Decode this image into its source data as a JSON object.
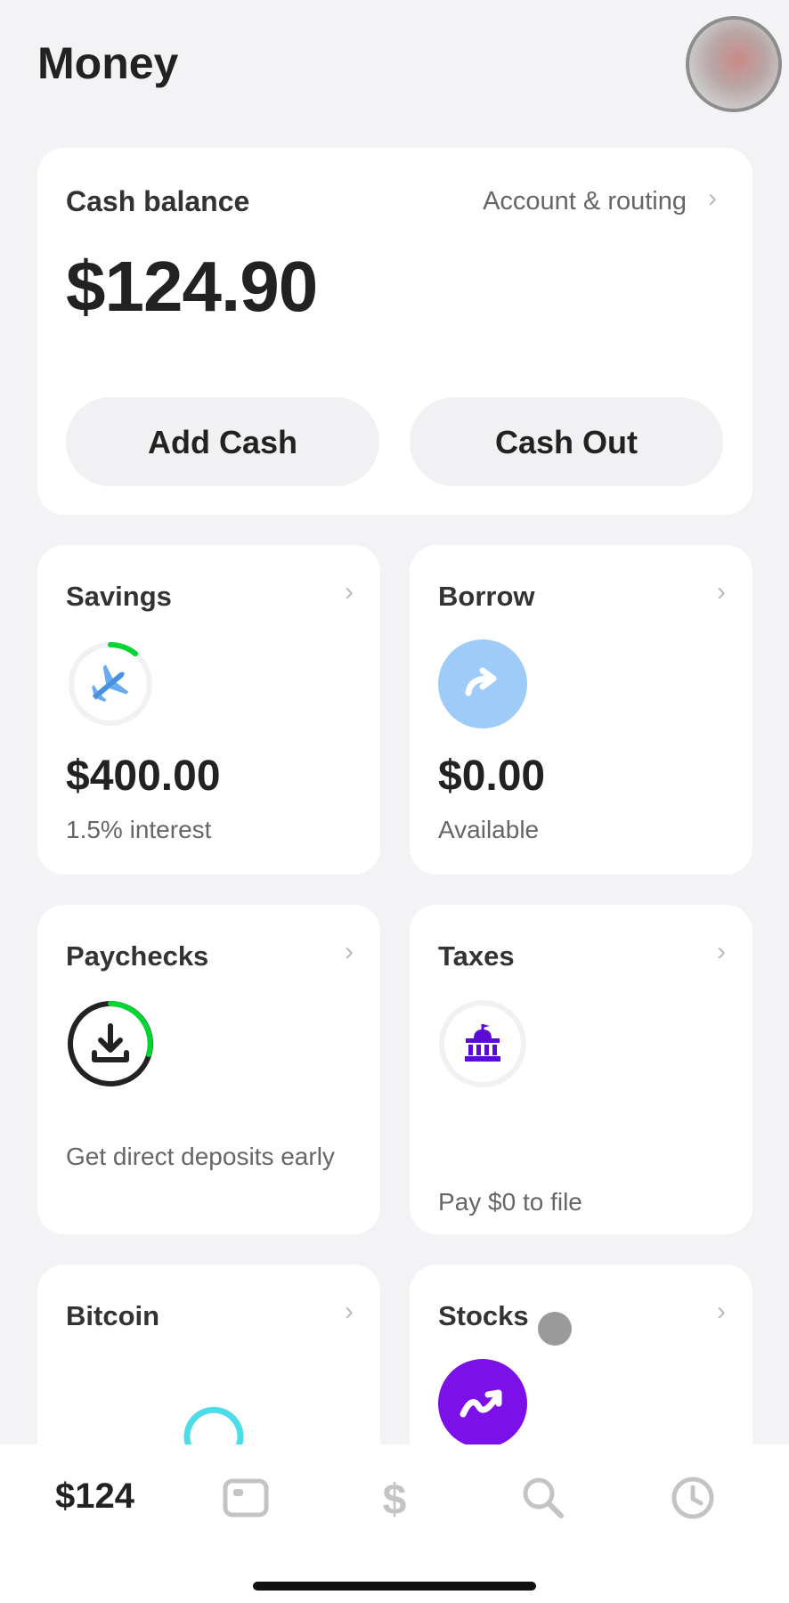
{
  "header": {
    "title": "Money"
  },
  "cash": {
    "label": "Cash balance",
    "account_link": "Account & routing",
    "balance": "$124.90",
    "add_cash": "Add Cash",
    "cash_out": "Cash Out"
  },
  "tiles": {
    "savings": {
      "label": "Savings",
      "amount": "$400.00",
      "sub": "1.5% interest",
      "progress": 0.12
    },
    "borrow": {
      "label": "Borrow",
      "amount": "$0.00",
      "sub": "Available"
    },
    "paychecks": {
      "label": "Paychecks",
      "sub": "Get direct deposits early"
    },
    "taxes": {
      "label": "Taxes",
      "sub": "Pay $0 to file"
    },
    "bitcoin": {
      "label": "Bitcoin"
    },
    "stocks": {
      "label": "Stocks"
    }
  },
  "tabbar": {
    "balance": "$124",
    "icons": [
      "card-icon",
      "dollar-icon",
      "search-icon",
      "clock-icon"
    ]
  },
  "colors": {
    "green": "#00d632",
    "borrow_blue": "#9ecbf7",
    "tax_purple": "#5a0bd6",
    "stocks_purple": "#7b10e8"
  }
}
